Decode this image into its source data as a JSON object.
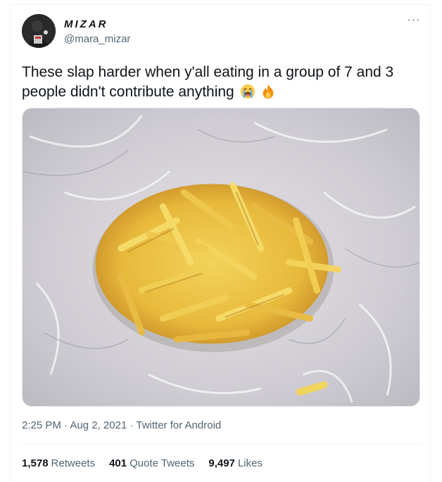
{
  "user": {
    "display_name": "MIZAR",
    "handle": "@mara_mizar",
    "avatar_icon": "user-avatar"
  },
  "menu": {
    "more_icon": "more-horizontal-icon",
    "more_label": "···"
  },
  "tweet": {
    "text": "These slap harder when y'all eating in a group of 7 and 3 people didn't contribute anything",
    "emojis": [
      "loudly-crying-face-icon",
      "fire-icon"
    ],
    "image_description_icon": "tweet-photo"
  },
  "meta": {
    "time": "2:25 PM",
    "sep1": " · ",
    "date": "Aug 2, 2021",
    "sep2": " · ",
    "source": "Twitter for Android"
  },
  "stats": {
    "retweets_count": "1,578",
    "retweets_label": "Retweets",
    "quotes_count": "401",
    "quotes_label": "Quote Tweets",
    "likes_count": "9,497",
    "likes_label": "Likes"
  },
  "colors": {
    "text_primary": "#0f1419",
    "text_secondary": "#536471",
    "divider": "#eff3f4"
  }
}
